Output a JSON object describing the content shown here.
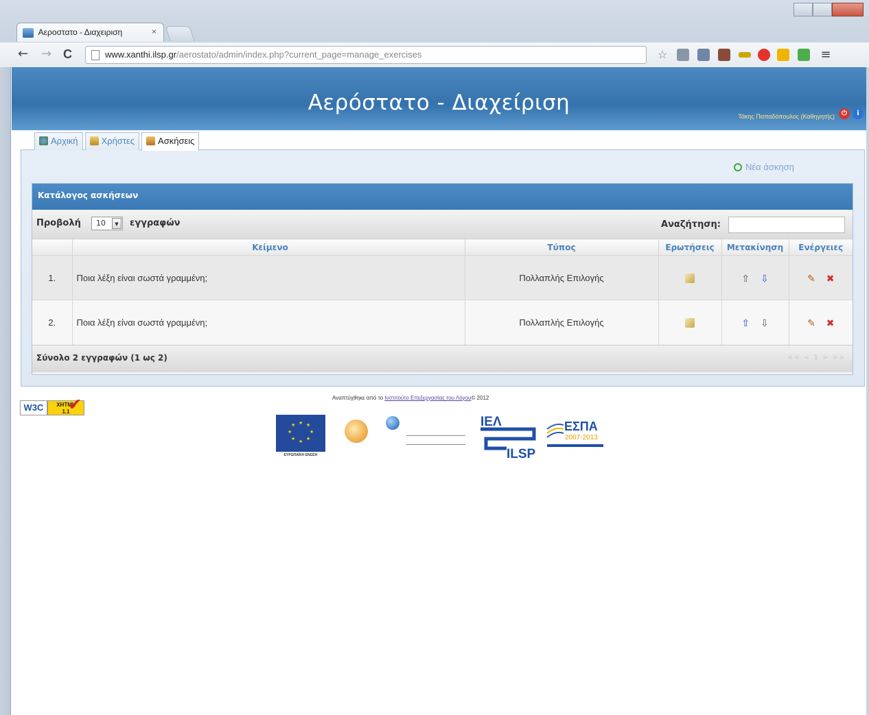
{
  "browser": {
    "tab_title": "Αεροστατο - Διαχειριση",
    "tab_close": "×",
    "back": "←",
    "forward": "→",
    "reload": "C",
    "url_host": "www.xanthi.ilsp.gr",
    "url_path": "/aerostato/admin/index.php?current_page=manage_exercises",
    "bookmark_star": "☆",
    "menu": "≡"
  },
  "header": {
    "title": "Αερόστατο - Διαχείριση",
    "user": "Τάκης Παπαδόπουλος (Καθηγητής)"
  },
  "nav_tabs": [
    {
      "label": "Αρχική"
    },
    {
      "label": "Χρήστες"
    },
    {
      "label": "Ασκήσεις"
    }
  ],
  "content": {
    "new_exercise": "Νέα άσκηση",
    "list_title": "Κατάλογος ασκήσεων",
    "show_label": "Προβολή",
    "page_size": "10",
    "records_label": "εγγραφών",
    "search_label": "Αναζήτηση:",
    "search_value": "",
    "columns": [
      "Κείμενο",
      "Τύπος",
      "Ερωτήσεις",
      "Μετακίνηση",
      "Ενέργειες"
    ],
    "rows": [
      {
        "num": "1.",
        "text": "Ποια λέξη είναι σωστά γραμμένη;",
        "type": "Πολλαπλής Επιλογής"
      },
      {
        "num": "2.",
        "text": "Ποια λέξη είναι σωστά γραμμένη;",
        "type": "Πολλαπλής Επιλογής"
      }
    ],
    "total": "Σύνολο 2 εγγραφών (1 ως 2)",
    "pager": "<< < 1 > >>"
  },
  "footer": {
    "credits_prefix": "Αναπτύχθηκε από το",
    "credits_link": "Ινστιτούτο Επεξεργασίας του Λόγου",
    "credits_suffix": "© 2012",
    "w3c": "W3C",
    "xhtml": "XHTML",
    "xhtml_version": "1.1",
    "iel_top": "ΙΕΛ",
    "iel_bottom": "ILSP",
    "espa": "ΕΣΠΑ",
    "espa_years": "2007-2013",
    "eu_caption": "ΕΥΡΩΠΑΪΚΗ ΕΝΩΣΗ"
  },
  "colors": {
    "header_blue": "#3d79b2",
    "tab_blue": "#4a85bf",
    "delete_red": "#d03030",
    "up_blue": "#1e44d6",
    "new_green": "#3fa83a"
  },
  "icons": [
    "home-icon",
    "users-icon",
    "exercises-icon",
    "add-icon",
    "edit-questions-icon",
    "move-up-icon",
    "move-down-icon",
    "edit-icon",
    "delete-icon",
    "logout-icon",
    "info-icon"
  ]
}
